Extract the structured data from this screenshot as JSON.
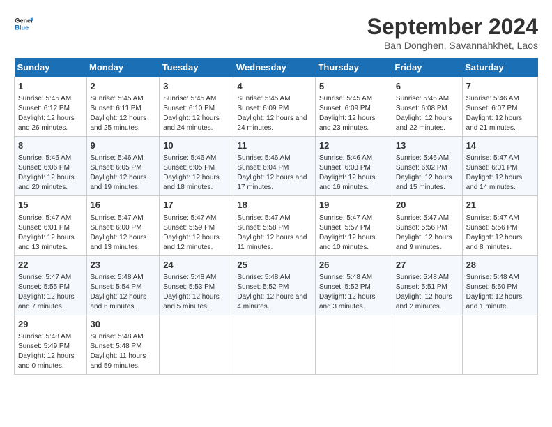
{
  "logo": {
    "line1": "General",
    "line2": "Blue"
  },
  "title": "September 2024",
  "subtitle": "Ban Donghen, Savannahkhet, Laos",
  "days_of_week": [
    "Sunday",
    "Monday",
    "Tuesday",
    "Wednesday",
    "Thursday",
    "Friday",
    "Saturday"
  ],
  "weeks": [
    [
      {
        "day": "1",
        "sunrise": "Sunrise: 5:45 AM",
        "sunset": "Sunset: 6:12 PM",
        "daylight": "Daylight: 12 hours and 26 minutes."
      },
      {
        "day": "2",
        "sunrise": "Sunrise: 5:45 AM",
        "sunset": "Sunset: 6:11 PM",
        "daylight": "Daylight: 12 hours and 25 minutes."
      },
      {
        "day": "3",
        "sunrise": "Sunrise: 5:45 AM",
        "sunset": "Sunset: 6:10 PM",
        "daylight": "Daylight: 12 hours and 24 minutes."
      },
      {
        "day": "4",
        "sunrise": "Sunrise: 5:45 AM",
        "sunset": "Sunset: 6:09 PM",
        "daylight": "Daylight: 12 hours and 24 minutes."
      },
      {
        "day": "5",
        "sunrise": "Sunrise: 5:45 AM",
        "sunset": "Sunset: 6:09 PM",
        "daylight": "Daylight: 12 hours and 23 minutes."
      },
      {
        "day": "6",
        "sunrise": "Sunrise: 5:46 AM",
        "sunset": "Sunset: 6:08 PM",
        "daylight": "Daylight: 12 hours and 22 minutes."
      },
      {
        "day": "7",
        "sunrise": "Sunrise: 5:46 AM",
        "sunset": "Sunset: 6:07 PM",
        "daylight": "Daylight: 12 hours and 21 minutes."
      }
    ],
    [
      {
        "day": "8",
        "sunrise": "Sunrise: 5:46 AM",
        "sunset": "Sunset: 6:06 PM",
        "daylight": "Daylight: 12 hours and 20 minutes."
      },
      {
        "day": "9",
        "sunrise": "Sunrise: 5:46 AM",
        "sunset": "Sunset: 6:05 PM",
        "daylight": "Daylight: 12 hours and 19 minutes."
      },
      {
        "day": "10",
        "sunrise": "Sunrise: 5:46 AM",
        "sunset": "Sunset: 6:05 PM",
        "daylight": "Daylight: 12 hours and 18 minutes."
      },
      {
        "day": "11",
        "sunrise": "Sunrise: 5:46 AM",
        "sunset": "Sunset: 6:04 PM",
        "daylight": "Daylight: 12 hours and 17 minutes."
      },
      {
        "day": "12",
        "sunrise": "Sunrise: 5:46 AM",
        "sunset": "Sunset: 6:03 PM",
        "daylight": "Daylight: 12 hours and 16 minutes."
      },
      {
        "day": "13",
        "sunrise": "Sunrise: 5:46 AM",
        "sunset": "Sunset: 6:02 PM",
        "daylight": "Daylight: 12 hours and 15 minutes."
      },
      {
        "day": "14",
        "sunrise": "Sunrise: 5:47 AM",
        "sunset": "Sunset: 6:01 PM",
        "daylight": "Daylight: 12 hours and 14 minutes."
      }
    ],
    [
      {
        "day": "15",
        "sunrise": "Sunrise: 5:47 AM",
        "sunset": "Sunset: 6:01 PM",
        "daylight": "Daylight: 12 hours and 13 minutes."
      },
      {
        "day": "16",
        "sunrise": "Sunrise: 5:47 AM",
        "sunset": "Sunset: 6:00 PM",
        "daylight": "Daylight: 12 hours and 13 minutes."
      },
      {
        "day": "17",
        "sunrise": "Sunrise: 5:47 AM",
        "sunset": "Sunset: 5:59 PM",
        "daylight": "Daylight: 12 hours and 12 minutes."
      },
      {
        "day": "18",
        "sunrise": "Sunrise: 5:47 AM",
        "sunset": "Sunset: 5:58 PM",
        "daylight": "Daylight: 12 hours and 11 minutes."
      },
      {
        "day": "19",
        "sunrise": "Sunrise: 5:47 AM",
        "sunset": "Sunset: 5:57 PM",
        "daylight": "Daylight: 12 hours and 10 minutes."
      },
      {
        "day": "20",
        "sunrise": "Sunrise: 5:47 AM",
        "sunset": "Sunset: 5:56 PM",
        "daylight": "Daylight: 12 hours and 9 minutes."
      },
      {
        "day": "21",
        "sunrise": "Sunrise: 5:47 AM",
        "sunset": "Sunset: 5:56 PM",
        "daylight": "Daylight: 12 hours and 8 minutes."
      }
    ],
    [
      {
        "day": "22",
        "sunrise": "Sunrise: 5:47 AM",
        "sunset": "Sunset: 5:55 PM",
        "daylight": "Daylight: 12 hours and 7 minutes."
      },
      {
        "day": "23",
        "sunrise": "Sunrise: 5:48 AM",
        "sunset": "Sunset: 5:54 PM",
        "daylight": "Daylight: 12 hours and 6 minutes."
      },
      {
        "day": "24",
        "sunrise": "Sunrise: 5:48 AM",
        "sunset": "Sunset: 5:53 PM",
        "daylight": "Daylight: 12 hours and 5 minutes."
      },
      {
        "day": "25",
        "sunrise": "Sunrise: 5:48 AM",
        "sunset": "Sunset: 5:52 PM",
        "daylight": "Daylight: 12 hours and 4 minutes."
      },
      {
        "day": "26",
        "sunrise": "Sunrise: 5:48 AM",
        "sunset": "Sunset: 5:52 PM",
        "daylight": "Daylight: 12 hours and 3 minutes."
      },
      {
        "day": "27",
        "sunrise": "Sunrise: 5:48 AM",
        "sunset": "Sunset: 5:51 PM",
        "daylight": "Daylight: 12 hours and 2 minutes."
      },
      {
        "day": "28",
        "sunrise": "Sunrise: 5:48 AM",
        "sunset": "Sunset: 5:50 PM",
        "daylight": "Daylight: 12 hours and 1 minute."
      }
    ],
    [
      {
        "day": "29",
        "sunrise": "Sunrise: 5:48 AM",
        "sunset": "Sunset: 5:49 PM",
        "daylight": "Daylight: 12 hours and 0 minutes."
      },
      {
        "day": "30",
        "sunrise": "Sunrise: 5:48 AM",
        "sunset": "Sunset: 5:48 PM",
        "daylight": "Daylight: 11 hours and 59 minutes."
      },
      null,
      null,
      null,
      null,
      null
    ]
  ]
}
